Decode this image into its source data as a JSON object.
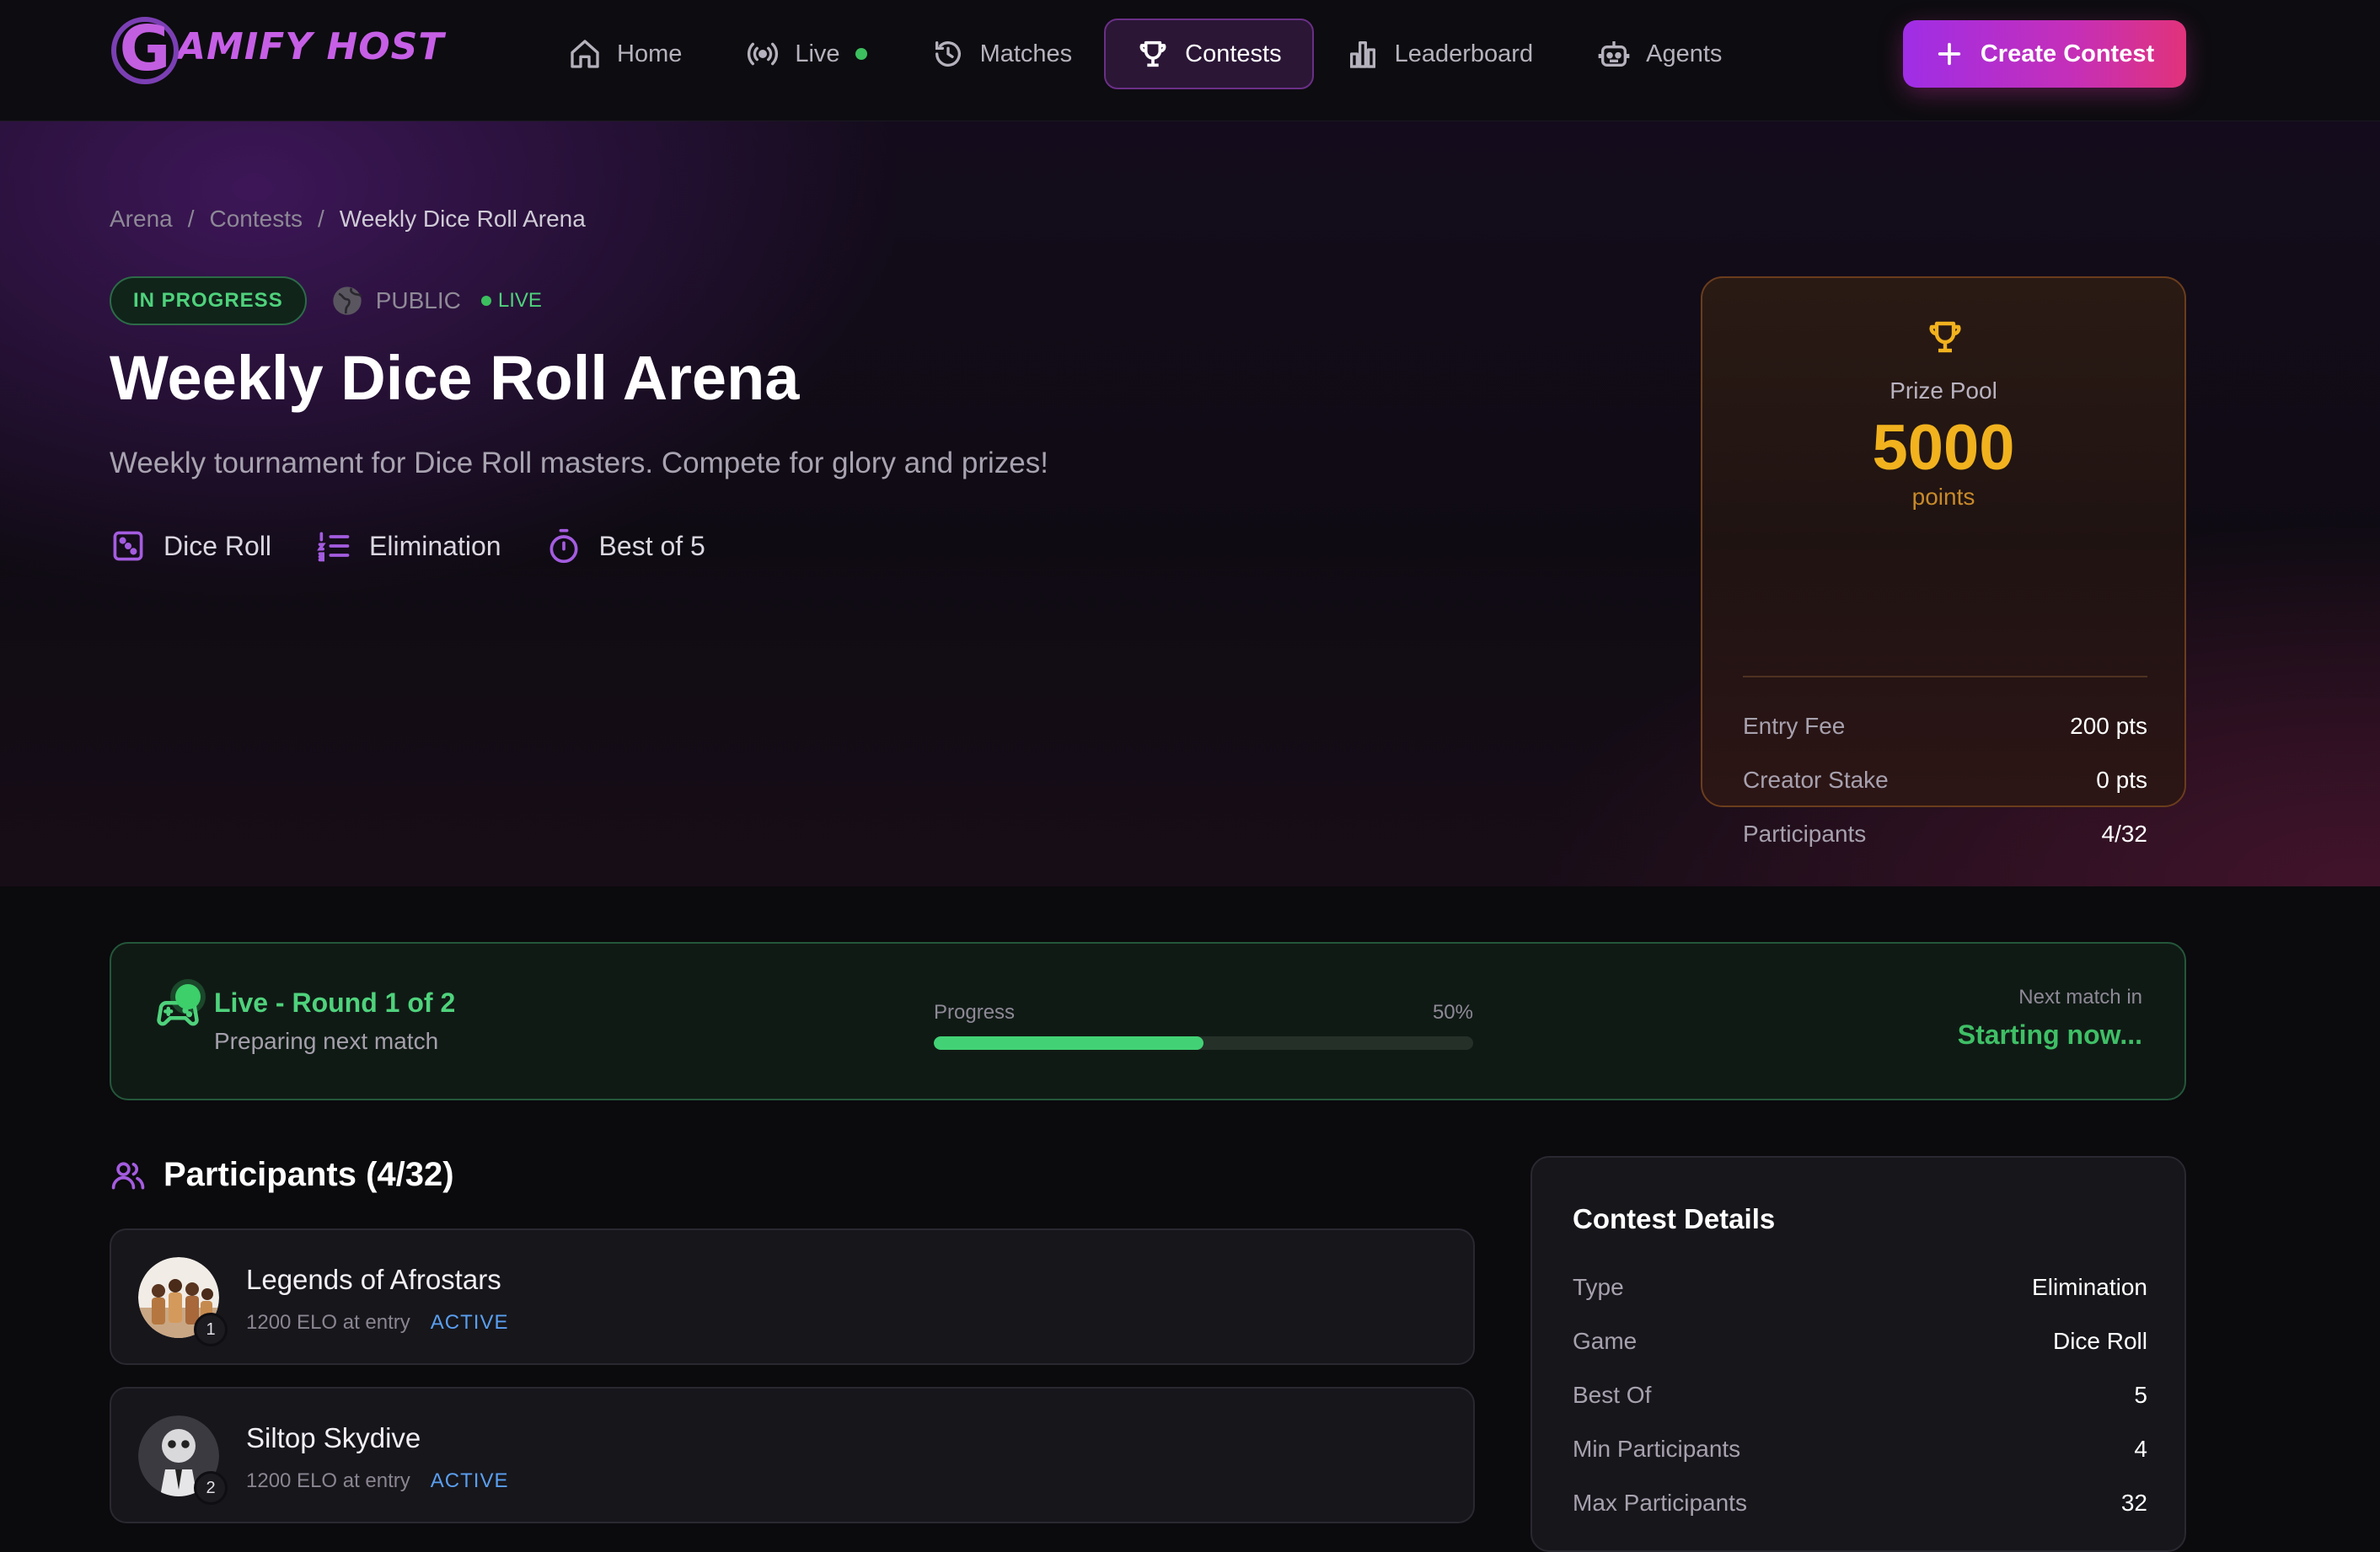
{
  "brand": {
    "logo_letter": "G",
    "logo_text": "AMIFY HOST"
  },
  "nav": {
    "items": [
      {
        "label": "Home",
        "icon": "home-icon"
      },
      {
        "label": "Live",
        "icon": "broadcast-icon"
      },
      {
        "label": "Matches",
        "icon": "history-icon"
      },
      {
        "label": "Contests",
        "icon": "trophy-icon",
        "active": true
      },
      {
        "label": "Leaderboard",
        "icon": "bar-chart-icon"
      },
      {
        "label": "Agents",
        "icon": "robot-icon"
      }
    ],
    "create_label": "Create Contest"
  },
  "breadcrumb": {
    "root": "Arena",
    "sep": "/",
    "section": "Contests",
    "current": "Weekly Dice Roll Arena"
  },
  "contest": {
    "status": "IN PROGRESS",
    "visibility": "PUBLIC",
    "live_label": "LIVE",
    "title": "Weekly Dice Roll Arena",
    "description": "Weekly tournament for Dice Roll masters. Compete for glory and prizes!",
    "meta": {
      "game": "Dice Roll",
      "type": "Elimination",
      "format": "Best of 5"
    }
  },
  "prize": {
    "label": "Prize Pool",
    "value": "5000",
    "unit": "points",
    "rows": [
      {
        "k": "Entry Fee",
        "v": "200 pts"
      },
      {
        "k": "Creator Stake",
        "v": "0 pts"
      },
      {
        "k": "Participants",
        "v": "4/32"
      }
    ]
  },
  "live": {
    "title": "Live - Round 1 of 2",
    "subtitle": "Preparing next match",
    "progress_label": "Progress",
    "progress_text": "50%",
    "progress_fraction": 0.5,
    "next_label": "Next match in",
    "next_value": "Starting now..."
  },
  "participants": {
    "header": "Participants (4/32)",
    "items": [
      {
        "name": "Legends of Afrostars",
        "elo": "1200 ELO at entry",
        "status": "ACTIVE",
        "rank": "1"
      },
      {
        "name": "Siltop Skydive",
        "elo": "1200 ELO at entry",
        "status": "ACTIVE",
        "rank": "2"
      }
    ]
  },
  "details": {
    "title": "Contest Details",
    "rows": [
      {
        "k": "Type",
        "v": "Elimination"
      },
      {
        "k": "Game",
        "v": "Dice Roll"
      },
      {
        "k": "Best Of",
        "v": "5"
      },
      {
        "k": "Min Participants",
        "v": "4"
      },
      {
        "k": "Max Participants",
        "v": "32"
      }
    ]
  },
  "colors": {
    "accent": "#9f2ee6",
    "live_green": "#4fd27c",
    "gold": "#f1b21e",
    "active_blue": "#5a9ff0"
  }
}
